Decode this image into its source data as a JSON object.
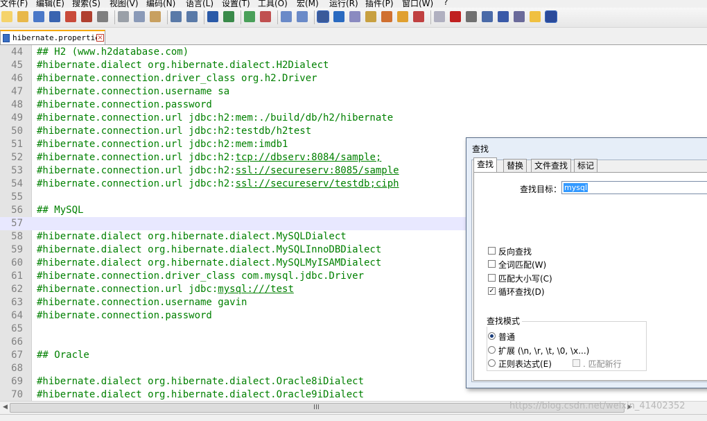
{
  "menu": [
    "文件(F)",
    "编辑(E)",
    "搜索(S)",
    "视图(V)",
    "编码(N)",
    "语言(L)",
    "设置(T)",
    "工具(O)",
    "宏(M)",
    "运行(R)",
    "插件(P)",
    "窗口(W)",
    "?"
  ],
  "toolbar_icons": [
    "new-file-icon",
    "open-file-icon",
    "save-icon",
    "save-all-icon",
    "close-icon",
    "close-all-icon",
    "print-icon",
    "cut-icon",
    "copy-icon",
    "paste-icon",
    "undo-icon",
    "redo-icon",
    "find-icon",
    "replace-icon",
    "zoom-in-icon",
    "zoom-out-icon",
    "sync-v-icon",
    "sync-h-icon",
    "word-wrap-icon",
    "show-all-chars-icon",
    "indent-guide-icon",
    "udl-icon",
    "doc-map-icon",
    "function-list-icon",
    "folder-workspace-icon",
    "monitor-icon",
    "record-macro-icon",
    "stop-macro-icon",
    "play-macro-icon",
    "run-macro-multiple-icon",
    "save-macro-icon",
    "spell-check-icon",
    "abc-icon"
  ],
  "tab": {
    "filename": "hibernate.properties",
    "close": "×"
  },
  "editor": {
    "lines": [
      {
        "num": "44",
        "text": "## H2 (www.h2database.com)"
      },
      {
        "num": "45",
        "text": "#hibernate.dialect org.hibernate.dialect.H2Dialect"
      },
      {
        "num": "46",
        "text": "#hibernate.connection.driver_class org.h2.Driver"
      },
      {
        "num": "47",
        "text": "#hibernate.connection.username sa"
      },
      {
        "num": "48",
        "text": "#hibernate.connection.password"
      },
      {
        "num": "49",
        "text": "#hibernate.connection.url jdbc:h2:mem:./build/db/h2/hibernate"
      },
      {
        "num": "50",
        "text": "#hibernate.connection.url jdbc:h2:testdb/h2test"
      },
      {
        "num": "51",
        "text": "#hibernate.connection.url jdbc:h2:mem:imdb1"
      },
      {
        "num": "52",
        "text": "#hibernate.connection.url jdbc:h2:",
        "link": "tcp://dbserv:8084/sample;"
      },
      {
        "num": "53",
        "text": "#hibernate.connection.url jdbc:h2:",
        "link": "ssl://secureserv:8085/sample"
      },
      {
        "num": "54",
        "text": "#hibernate.connection.url jdbc:h2:",
        "link": "ssl://secureserv/testdb;ciph"
      },
      {
        "num": "55",
        "text": ""
      },
      {
        "num": "56",
        "text": "## MySQL"
      },
      {
        "num": "57",
        "text": "",
        "current": true
      },
      {
        "num": "58",
        "text": "#hibernate.dialect org.hibernate.dialect.MySQLDialect"
      },
      {
        "num": "59",
        "text": "#hibernate.dialect org.hibernate.dialect.MySQLInnoDBDialect"
      },
      {
        "num": "60",
        "text": "#hibernate.dialect org.hibernate.dialect.MySQLMyISAMDialect"
      },
      {
        "num": "61",
        "text": "#hibernate.connection.driver_class com.mysql.jdbc.Driver"
      },
      {
        "num": "62",
        "text": "#hibernate.connection.url jdbc:",
        "link": "mysql:///test"
      },
      {
        "num": "63",
        "text": "#hibernate.connection.username gavin"
      },
      {
        "num": "64",
        "text": "#hibernate.connection.password"
      },
      {
        "num": "65",
        "text": ""
      },
      {
        "num": "66",
        "text": ""
      },
      {
        "num": "67",
        "text": "## Oracle"
      },
      {
        "num": "68",
        "text": ""
      },
      {
        "num": "69",
        "text": "#hibernate.dialect org.hibernate.dialect.Oracle8iDialect"
      },
      {
        "num": "70",
        "text": "#hibernate.dialect org.hibernate.dialect.Oracle9iDialect"
      }
    ]
  },
  "scrollbar": {
    "grip": "III"
  },
  "watermark": "https://blog.csdn.net/weixin_41402352",
  "find_dialog": {
    "title": "查找",
    "tabs": [
      "查找",
      "替换",
      "文件查找",
      "标记"
    ],
    "search_label": "查找目标：",
    "search_value": "mysql",
    "options": [
      {
        "label": "反向查找",
        "checked": false
      },
      {
        "label": "全词匹配(W)",
        "checked": false
      },
      {
        "label": "匹配大小写(C)",
        "checked": false
      },
      {
        "label": "循环查找(D)",
        "checked": true
      }
    ],
    "mode_label": "查找模式",
    "modes": [
      {
        "label": "普通",
        "selected": true
      },
      {
        "label": "扩展 (\\n, \\r, \\t, \\0, \\x...)",
        "selected": false
      },
      {
        "label": "正则表达式(E)",
        "selected": false
      }
    ],
    "newline_option": ". 匹配新行"
  },
  "colors": {
    "code_green": "#008000",
    "line_number": "#808080",
    "current_line": "#e8e8ff",
    "selection": "#3399ff"
  }
}
